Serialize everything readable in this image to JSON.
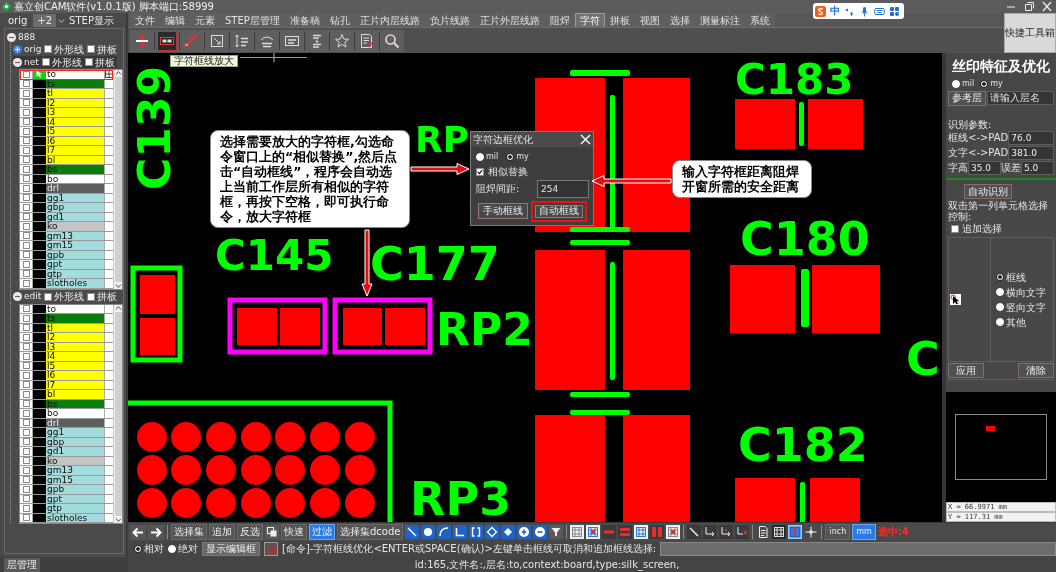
{
  "window": {
    "title": "嘉立创CAM软件(v1.0.1版) 脚本端口:58999"
  },
  "ime_bar": {
    "mode": "中"
  },
  "menu": [
    {
      "label": "文件",
      "selected": false
    },
    {
      "label": "编辑",
      "selected": false
    },
    {
      "label": "元素",
      "selected": false
    },
    {
      "label": "STEP层管理",
      "selected": false
    },
    {
      "label": "准备稿",
      "selected": false
    },
    {
      "label": "钻孔",
      "selected": false
    },
    {
      "label": "正片内层线路",
      "selected": false
    },
    {
      "label": "负片线路",
      "selected": false
    },
    {
      "label": "正片外层线路",
      "selected": false
    },
    {
      "label": "阻焊",
      "selected": false
    },
    {
      "label": "字符",
      "selected": true
    },
    {
      "label": "拼板",
      "selected": false
    },
    {
      "label": "视图",
      "selected": false
    },
    {
      "label": "选择",
      "selected": false
    },
    {
      "label": "测量标注",
      "selected": false
    },
    {
      "label": "系统",
      "selected": false
    }
  ],
  "quick_toolbox": "快捷工具箱",
  "toolbar": {
    "buttons": [
      {
        "selected": false
      },
      {
        "selected": true
      },
      {
        "selected": false
      },
      {
        "selected": false
      },
      {
        "selected": false
      },
      {
        "selected": false
      },
      {
        "selected": false
      },
      {
        "selected": false
      },
      {
        "selected": false
      },
      {
        "selected": false
      },
      {
        "selected": false
      }
    ],
    "tooltip": "字符框线放大"
  },
  "left_panel": {
    "tabs": [
      {
        "label": "orig",
        "selected": false
      },
      {
        "label": "+2",
        "selected": true
      }
    ],
    "step_label": "STEP显示",
    "tree": {
      "label": "888",
      "expanded": true,
      "children": [
        {
          "label": "orig",
          "expanded": false,
          "selected": false,
          "options": [
            {
              "label": "外形线",
              "checked": false
            },
            {
              "label": "拼板",
              "checked": false
            }
          ]
        },
        {
          "label": "net",
          "expanded": true,
          "selected": true,
          "options": [
            {
              "label": "外形线",
              "checked": false
            },
            {
              "label": "拼板",
              "checked": false
            }
          ],
          "layers": [
            {
              "name": "to",
              "color": "#ffffff",
              "checked": false,
              "selected": true
            },
            {
              "name": "ts",
              "color": "#0a7d0a",
              "checked": false,
              "selected": false
            },
            {
              "name": "tl",
              "color": "#ffff00",
              "checked": false,
              "selected": false
            },
            {
              "name": "l2",
              "color": "#ffff00",
              "checked": false,
              "selected": false
            },
            {
              "name": "l3",
              "color": "#ffff00",
              "checked": false,
              "selected": false
            },
            {
              "name": "l4",
              "color": "#ffff00",
              "checked": false,
              "selected": false
            },
            {
              "name": "l5",
              "color": "#ffff00",
              "checked": false,
              "selected": false
            },
            {
              "name": "l6",
              "color": "#ffff00",
              "checked": false,
              "selected": false
            },
            {
              "name": "l7",
              "color": "#ffff00",
              "checked": false,
              "selected": false
            },
            {
              "name": "bl",
              "color": "#ffff00",
              "checked": false,
              "selected": false
            },
            {
              "name": "bs",
              "color": "#0a7d0a",
              "checked": false,
              "selected": false
            },
            {
              "name": "bo",
              "color": "#ffffff",
              "checked": false,
              "selected": false
            },
            {
              "name": "drl",
              "color": "#5e5e5e",
              "checked": false,
              "selected": false
            },
            {
              "name": "gg1",
              "color": "#a2dcdc",
              "checked": false,
              "selected": false
            },
            {
              "name": "gbp",
              "color": "#a2dcdc",
              "checked": false,
              "selected": false
            },
            {
              "name": "gd1",
              "color": "#a2dcdc",
              "checked": false,
              "selected": false
            },
            {
              "name": "ko",
              "color": "#c4c4c4",
              "checked": false,
              "selected": false
            },
            {
              "name": "gm13",
              "color": "#a2dcdc",
              "checked": false,
              "selected": false
            },
            {
              "name": "gm15",
              "color": "#a2dcdc",
              "checked": false,
              "selected": false
            },
            {
              "name": "gpb",
              "color": "#a2dcdc",
              "checked": false,
              "selected": false
            },
            {
              "name": "gpt",
              "color": "#a2dcdc",
              "checked": false,
              "selected": false
            },
            {
              "name": "gtp",
              "color": "#a2dcdc",
              "checked": false,
              "selected": false
            },
            {
              "name": "slotholes",
              "color": "#a2dcdc",
              "checked": false,
              "selected": false
            }
          ]
        },
        {
          "label": "edit",
          "expanded": true,
          "selected": false,
          "options": [
            {
              "label": "外形线",
              "checked": false
            },
            {
              "label": "拼板",
              "checked": false
            }
          ],
          "layers": [
            {
              "name": "to",
              "color": "#ffffff",
              "checked": false,
              "selected": false
            },
            {
              "name": "ts",
              "color": "#0a7d0a",
              "checked": false,
              "selected": false
            },
            {
              "name": "tl",
              "color": "#ffff00",
              "checked": false,
              "selected": false
            },
            {
              "name": "l2",
              "color": "#ffff00",
              "checked": false,
              "selected": false
            },
            {
              "name": "l3",
              "color": "#ffff00",
              "checked": false,
              "selected": false
            },
            {
              "name": "l4",
              "color": "#ffff00",
              "checked": false,
              "selected": false
            },
            {
              "name": "l5",
              "color": "#ffff00",
              "checked": false,
              "selected": false
            },
            {
              "name": "l6",
              "color": "#ffff00",
              "checked": false,
              "selected": false
            },
            {
              "name": "l7",
              "color": "#ffff00",
              "checked": false,
              "selected": false
            },
            {
              "name": "bl",
              "color": "#ffff00",
              "checked": false,
              "selected": false
            },
            {
              "name": "bs",
              "color": "#0a7d0a",
              "checked": false,
              "selected": false
            },
            {
              "name": "bo",
              "color": "#ffffff",
              "checked": false,
              "selected": false
            },
            {
              "name": "drl",
              "color": "#5e5e5e",
              "checked": false,
              "selected": false
            },
            {
              "name": "gg1",
              "color": "#a2dcdc",
              "checked": false,
              "selected": false
            },
            {
              "name": "gbp",
              "color": "#a2dcdc",
              "checked": false,
              "selected": false
            },
            {
              "name": "gd1",
              "color": "#a2dcdc",
              "checked": false,
              "selected": false
            },
            {
              "name": "ko",
              "color": "#c4c4c4",
              "checked": false,
              "selected": false
            },
            {
              "name": "gm13",
              "color": "#a2dcdc",
              "checked": false,
              "selected": false
            },
            {
              "name": "gm15",
              "color": "#a2dcdc",
              "checked": false,
              "selected": false
            },
            {
              "name": "gpb",
              "color": "#a2dcdc",
              "checked": false,
              "selected": false
            },
            {
              "name": "gpt",
              "color": "#a2dcdc",
              "checked": false,
              "selected": false
            },
            {
              "name": "gtp",
              "color": "#a2dcdc",
              "checked": false,
              "selected": false
            },
            {
              "name": "slotholes",
              "color": "#a2dcdc",
              "checked": false,
              "selected": false
            }
          ]
        }
      ]
    },
    "bottom_tab": "层管理"
  },
  "canvas": {
    "silkscreen_labels": [
      "C183",
      "C139",
      "RP",
      "C145",
      "C177",
      "C180",
      "RP2",
      "C",
      "C182",
      "RP3"
    ],
    "frames": [
      {
        "selected": false
      },
      {
        "selected": true
      },
      {
        "selected": true
      }
    ]
  },
  "callouts": [
    "选择需要放大的字符框,勾选命令窗口上的“相似替换”,然后点击“自动框线”，程序会自动选上当前工作层所有相似的字符框，再按下空格，即可执行命令，放大字符框",
    "输入字符框距离阻焊开窗所需的安全距离"
  ],
  "dialog": {
    "title": "字符边框优化",
    "units": [
      {
        "label": "mil",
        "selected": false
      },
      {
        "label": "my",
        "selected": true
      }
    ],
    "similar": {
      "label": "相似替换",
      "checked": true
    },
    "gap": {
      "label": "阻焊间距:",
      "value": "254"
    },
    "buttons": [
      {
        "label": "手动框线",
        "highlighted": false
      },
      {
        "label": "自动框线",
        "highlighted": true
      }
    ]
  },
  "right_panel": {
    "title": "丝印特征及优化",
    "units": [
      {
        "label": "mil",
        "selected": false
      },
      {
        "label": "my",
        "selected": true
      }
    ],
    "reference": {
      "button": "参考层",
      "placeholder": "请输入层名"
    },
    "params_title": "识别参数:",
    "params": [
      {
        "label": "框线<->PAD",
        "value": "76.0"
      },
      {
        "label": "文字<->PAD",
        "value": "381.0"
      },
      {
        "label": "字高",
        "value": "35.0"
      },
      {
        "label": "误差",
        "value": "5.0"
      }
    ],
    "detect_button": "自动识别",
    "hint": "双击第一列单元格选择控制:",
    "append": {
      "label": "追加选择",
      "checked": false
    },
    "types": [
      {
        "label": "框线",
        "selected": true
      },
      {
        "label": "横向文字",
        "selected": false
      },
      {
        "label": "竖向文字",
        "selected": false
      },
      {
        "label": "其他",
        "selected": false
      }
    ],
    "actions": [
      "应用",
      "清除"
    ],
    "coords": [
      "X = 66.9971 mm",
      "Y = 117.31 mm"
    ]
  },
  "bottom_toolbar": {
    "buttons": [
      {
        "label": "选择集",
        "active": false
      },
      {
        "label": "追加",
        "active": false
      },
      {
        "label": "反选",
        "active": false
      },
      {
        "label": "快速",
        "active": false
      },
      {
        "label": "过滤",
        "active": true
      },
      {
        "label": "选择集dcode",
        "active": false
      }
    ],
    "tools": [
      {
        "active": false
      },
      {
        "active": false
      },
      {
        "active": false
      },
      {
        "active": false
      },
      {
        "active": false
      },
      {
        "active": false
      },
      {
        "active": false
      },
      {
        "active": false
      },
      {
        "active": false
      },
      {
        "active": false
      },
      {
        "active": false
      },
      {
        "active": false
      },
      {
        "active": false
      },
      {
        "active": false
      },
      {
        "active": false
      },
      {
        "active": false
      },
      {
        "active": false
      },
      {
        "active": false
      },
      {
        "active": false
      },
      {
        "active": false
      },
      {
        "active": false
      },
      {
        "active": false
      },
      {
        "active": false
      },
      {
        "active": true
      },
      {
        "active": false
      }
    ],
    "units": [
      {
        "label": "inch",
        "selected": false
      },
      {
        "label": "mm",
        "selected": true
      }
    ],
    "selection": "选中:4"
  },
  "command_bar": {
    "coord_modes": [
      {
        "label": "相对",
        "selected": true
      },
      {
        "label": "绝对",
        "selected": false
      }
    ],
    "editor_button": "显示编辑框",
    "prompt": "[命令]-字符框线优化<ENTER或SPACE(确认)>左键单击框线可取消和追加框线选择:"
  },
  "status_bar": "id:165,文件名:,层名:to,context:board,type:silk_screen,"
}
